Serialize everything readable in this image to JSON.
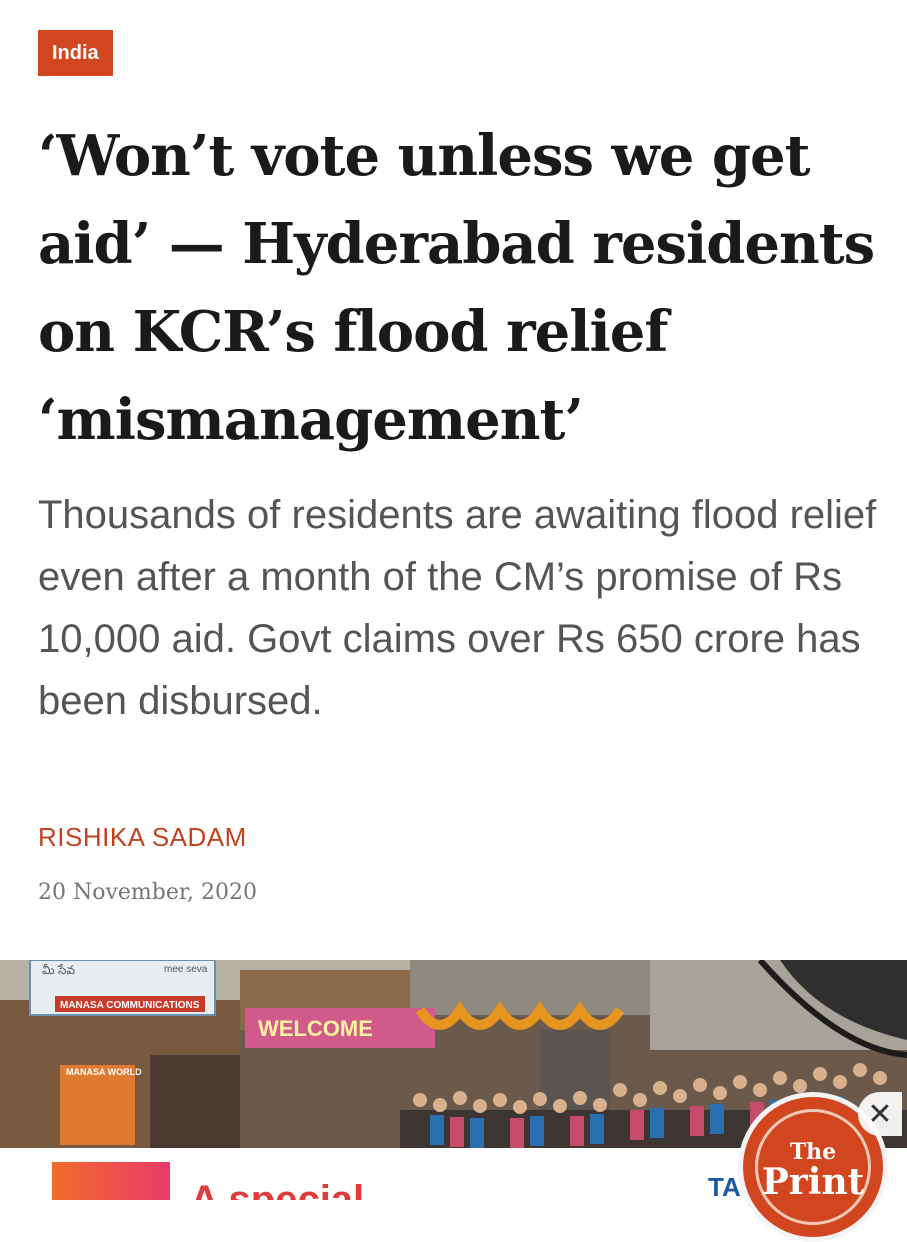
{
  "article": {
    "category": "India",
    "headline": "‘Won’t vote unless we get aid’ — Hyderabad residents on KCR’s flood relief ‘mismanagement’",
    "summary": "Thousands of residents are awaiting flood relief even after a month of the CM’s promise of Rs 10,000 aid. Govt claims over Rs 650 crore has been disbursed.",
    "author": "RISHIKA SADAM",
    "date": "20 November, 2020"
  },
  "photo": {
    "signs": [
      "MANASA COMMUNICATIONS",
      "mee seva",
      "WELCOME",
      "MANASA WORLD"
    ]
  },
  "ad": {
    "text": "A special",
    "brand": "TA"
  },
  "logo": {
    "line1": "The",
    "line2": "Print"
  },
  "colors": {
    "accent": "#d1461f",
    "headline": "#1a1a1a",
    "summary": "#555555"
  },
  "icons": {
    "close": "close-icon"
  }
}
